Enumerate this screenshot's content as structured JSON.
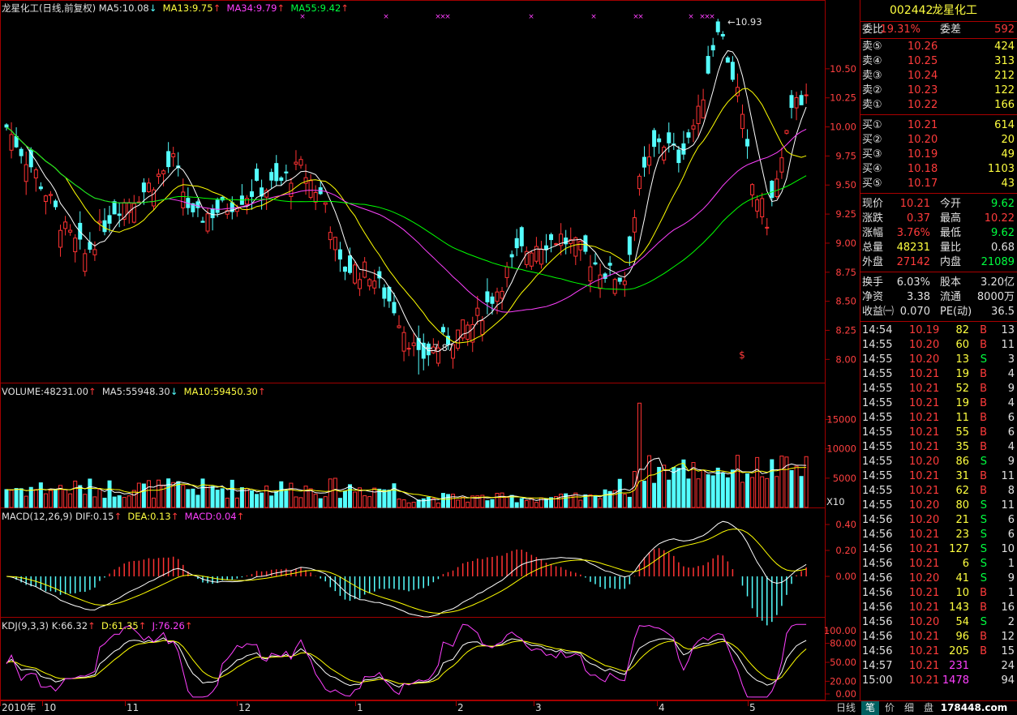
{
  "stock": {
    "code": "002442",
    "name": "龙星化工"
  },
  "main_header": {
    "title": "龙星化工(日线,前复权)",
    "ma5": "MA5:10.08",
    "ma13": "MA13:9.75",
    "ma34": "MA34:9.79",
    "ma55": "MA55:9.42"
  },
  "volume_header": {
    "title": "VOLUME:48231.00",
    "ma5": "MA5:55948.30",
    "ma10": "MA10:59450.30",
    "unit": "X10"
  },
  "macd_header": {
    "title": "MACD(12,26,9)",
    "dif": "DIF:0.15",
    "dea": "DEA:0.13",
    "macd": "MACD:0.04"
  },
  "kdj_header": {
    "title": "KDJ(9,3,3)",
    "k": "K:66.32",
    "d": "D:61.35",
    "j": "J:76.26"
  },
  "annotations": {
    "high": "10.93",
    "low": "7.87"
  },
  "x_axis": {
    "labels": [
      "2010年",
      "10",
      "11",
      "12",
      "1",
      "2",
      "3",
      "4",
      "5"
    ],
    "period": "日线"
  },
  "price_axis": [
    "10.50",
    "10.25",
    "10.00",
    "9.75",
    "9.50",
    "9.25",
    "9.00",
    "8.75",
    "8.50",
    "8.25",
    "8.00"
  ],
  "volume_axis": [
    "15000",
    "10000",
    "5000"
  ],
  "macd_axis": [
    "0.40",
    "0.20",
    "0.00"
  ],
  "kdj_axis": [
    "100.00",
    "80.00",
    "50.00",
    "20.00",
    "0.00"
  ],
  "quote": {
    "weibi_label": "委比",
    "weibi": "19.31%",
    "weicha_label": "委差",
    "weicha": "592",
    "asks": [
      {
        "label": "卖⑤",
        "price": "10.26",
        "vol": "424"
      },
      {
        "label": "卖④",
        "price": "10.25",
        "vol": "313"
      },
      {
        "label": "卖③",
        "price": "10.24",
        "vol": "212"
      },
      {
        "label": "卖②",
        "price": "10.23",
        "vol": "122"
      },
      {
        "label": "卖①",
        "price": "10.22",
        "vol": "166"
      }
    ],
    "bids": [
      {
        "label": "买①",
        "price": "10.21",
        "vol": "614"
      },
      {
        "label": "买②",
        "price": "10.20",
        "vol": "20"
      },
      {
        "label": "买③",
        "price": "10.19",
        "vol": "49"
      },
      {
        "label": "买④",
        "price": "10.18",
        "vol": "1103"
      },
      {
        "label": "买⑤",
        "price": "10.17",
        "vol": "43"
      }
    ],
    "stats": [
      {
        "l1": "现价",
        "v1": "10.21",
        "c1": "red",
        "l2": "今开",
        "v2": "9.62",
        "c2": "green"
      },
      {
        "l1": "涨跌",
        "v1": "0.37",
        "c1": "red",
        "l2": "最高",
        "v2": "10.22",
        "c2": "red"
      },
      {
        "l1": "涨幅",
        "v1": "3.76%",
        "c1": "red",
        "l2": "最低",
        "v2": "9.62",
        "c2": "green"
      },
      {
        "l1": "总量",
        "v1": "48231",
        "c1": "yellow",
        "l2": "量比",
        "v2": "0.68",
        "c2": "white"
      },
      {
        "l1": "外盘",
        "v1": "27142",
        "c1": "red",
        "l2": "内盘",
        "v2": "21089",
        "c2": "green"
      }
    ],
    "stats2": [
      {
        "l1": "换手",
        "v1": "6.03%",
        "l2": "股本",
        "v2": "3.20亿"
      },
      {
        "l1": "净资",
        "v1": "3.38",
        "l2": "流通",
        "v2": "8000万"
      },
      {
        "l1": "收益㈠",
        "v1": "0.070",
        "l2": "PE(动)",
        "v2": "36.5"
      }
    ]
  },
  "ticks": [
    {
      "t": "14:54",
      "p": "10.19",
      "v": "82",
      "s": "B",
      "n": "13"
    },
    {
      "t": "14:55",
      "p": "10.20",
      "v": "60",
      "s": "B",
      "n": "11"
    },
    {
      "t": "14:55",
      "p": "10.20",
      "v": "13",
      "s": "S",
      "n": "3"
    },
    {
      "t": "14:55",
      "p": "10.21",
      "v": "19",
      "s": "B",
      "n": "4"
    },
    {
      "t": "14:55",
      "p": "10.21",
      "v": "52",
      "s": "B",
      "n": "9"
    },
    {
      "t": "14:55",
      "p": "10.21",
      "v": "19",
      "s": "B",
      "n": "4"
    },
    {
      "t": "14:55",
      "p": "10.21",
      "v": "11",
      "s": "B",
      "n": "6"
    },
    {
      "t": "14:55",
      "p": "10.21",
      "v": "55",
      "s": "B",
      "n": "6"
    },
    {
      "t": "14:55",
      "p": "10.21",
      "v": "35",
      "s": "B",
      "n": "4"
    },
    {
      "t": "14:55",
      "p": "10.20",
      "v": "86",
      "s": "S",
      "n": "9"
    },
    {
      "t": "14:55",
      "p": "10.21",
      "v": "31",
      "s": "B",
      "n": "11"
    },
    {
      "t": "14:55",
      "p": "10.21",
      "v": "62",
      "s": "B",
      "n": "8"
    },
    {
      "t": "14:55",
      "p": "10.20",
      "v": "80",
      "s": "S",
      "n": "11"
    },
    {
      "t": "14:56",
      "p": "10.20",
      "v": "21",
      "s": "S",
      "n": "6"
    },
    {
      "t": "14:56",
      "p": "10.21",
      "v": "23",
      "s": "S",
      "n": "6"
    },
    {
      "t": "14:56",
      "p": "10.21",
      "v": "127",
      "s": "S",
      "n": "10"
    },
    {
      "t": "14:56",
      "p": "10.21",
      "v": "6",
      "s": "S",
      "n": "1"
    },
    {
      "t": "14:56",
      "p": "10.20",
      "v": "41",
      "s": "S",
      "n": "9"
    },
    {
      "t": "14:56",
      "p": "10.21",
      "v": "10",
      "s": "B",
      "n": "1"
    },
    {
      "t": "14:56",
      "p": "10.21",
      "v": "143",
      "s": "B",
      "n": "16"
    },
    {
      "t": "14:56",
      "p": "10.20",
      "v": "54",
      "s": "S",
      "n": "2"
    },
    {
      "t": "14:56",
      "p": "10.21",
      "v": "96",
      "s": "B",
      "n": "12"
    },
    {
      "t": "14:56",
      "p": "10.21",
      "v": "205",
      "s": "B",
      "n": "15"
    },
    {
      "t": "14:57",
      "p": "10.21",
      "v": "231",
      "s": "",
      "n": "24"
    },
    {
      "t": "15:00",
      "p": "10.21",
      "v": "1478",
      "s": "",
      "n": "94"
    }
  ],
  "bottom_tabs": [
    "笔",
    "价",
    "细",
    "盘"
  ],
  "watermark": "178448.com",
  "colors": {
    "up": "#ff3232",
    "down": "#54ffff",
    "ma5": "#ffffff",
    "ma13": "#ffff00",
    "ma34": "#ff40ff",
    "ma55": "#00ff00",
    "grid": "#a00000"
  }
}
